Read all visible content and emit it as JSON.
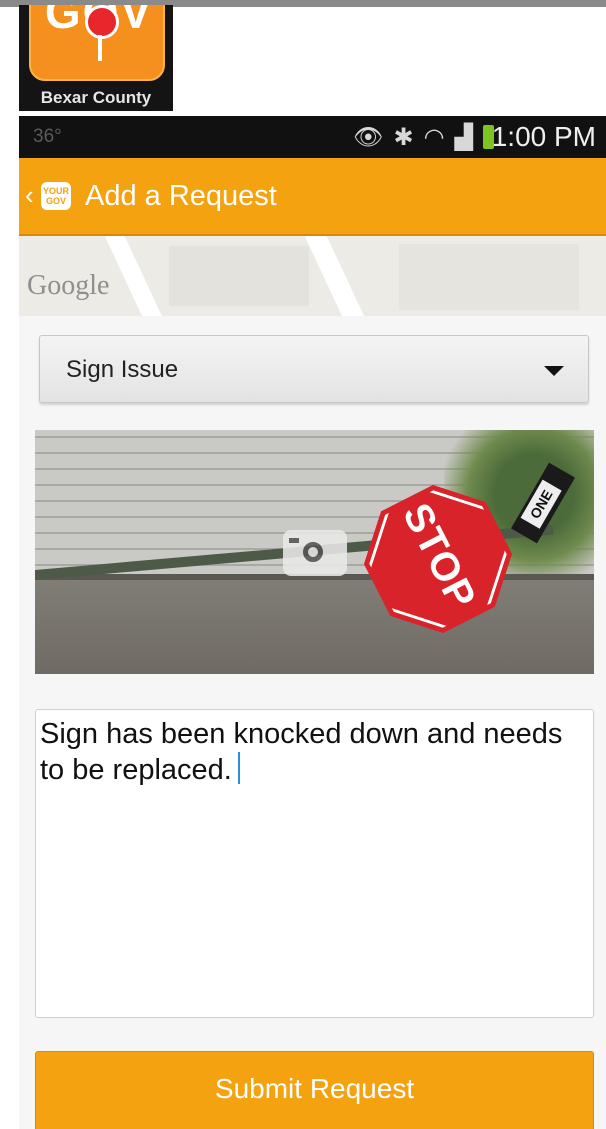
{
  "app_logo": {
    "wordmark": "GOV",
    "caption": "Bexar County"
  },
  "status_bar": {
    "temperature": "36°",
    "time": "1:00 PM",
    "icons": [
      "eye-icon",
      "bluetooth-icon",
      "wifi-icon",
      "signal-icon",
      "battery-icon"
    ]
  },
  "action_bar": {
    "app_icon_text": "YOUR GOV",
    "title": "Add a Request"
  },
  "map": {
    "attribution": "Google"
  },
  "request_form": {
    "category_selected": "Sign Issue",
    "photo": {
      "sign_text": "STOP",
      "secondary_sign_text": "ONE"
    },
    "description": "Sign has been knocked down and needs to be replaced.",
    "submit_label": "Submit Request"
  },
  "colors": {
    "accent": "#f5a210",
    "status_bar": "#111111",
    "cursor": "#2a8fd8",
    "stop_red": "#d8232a"
  }
}
